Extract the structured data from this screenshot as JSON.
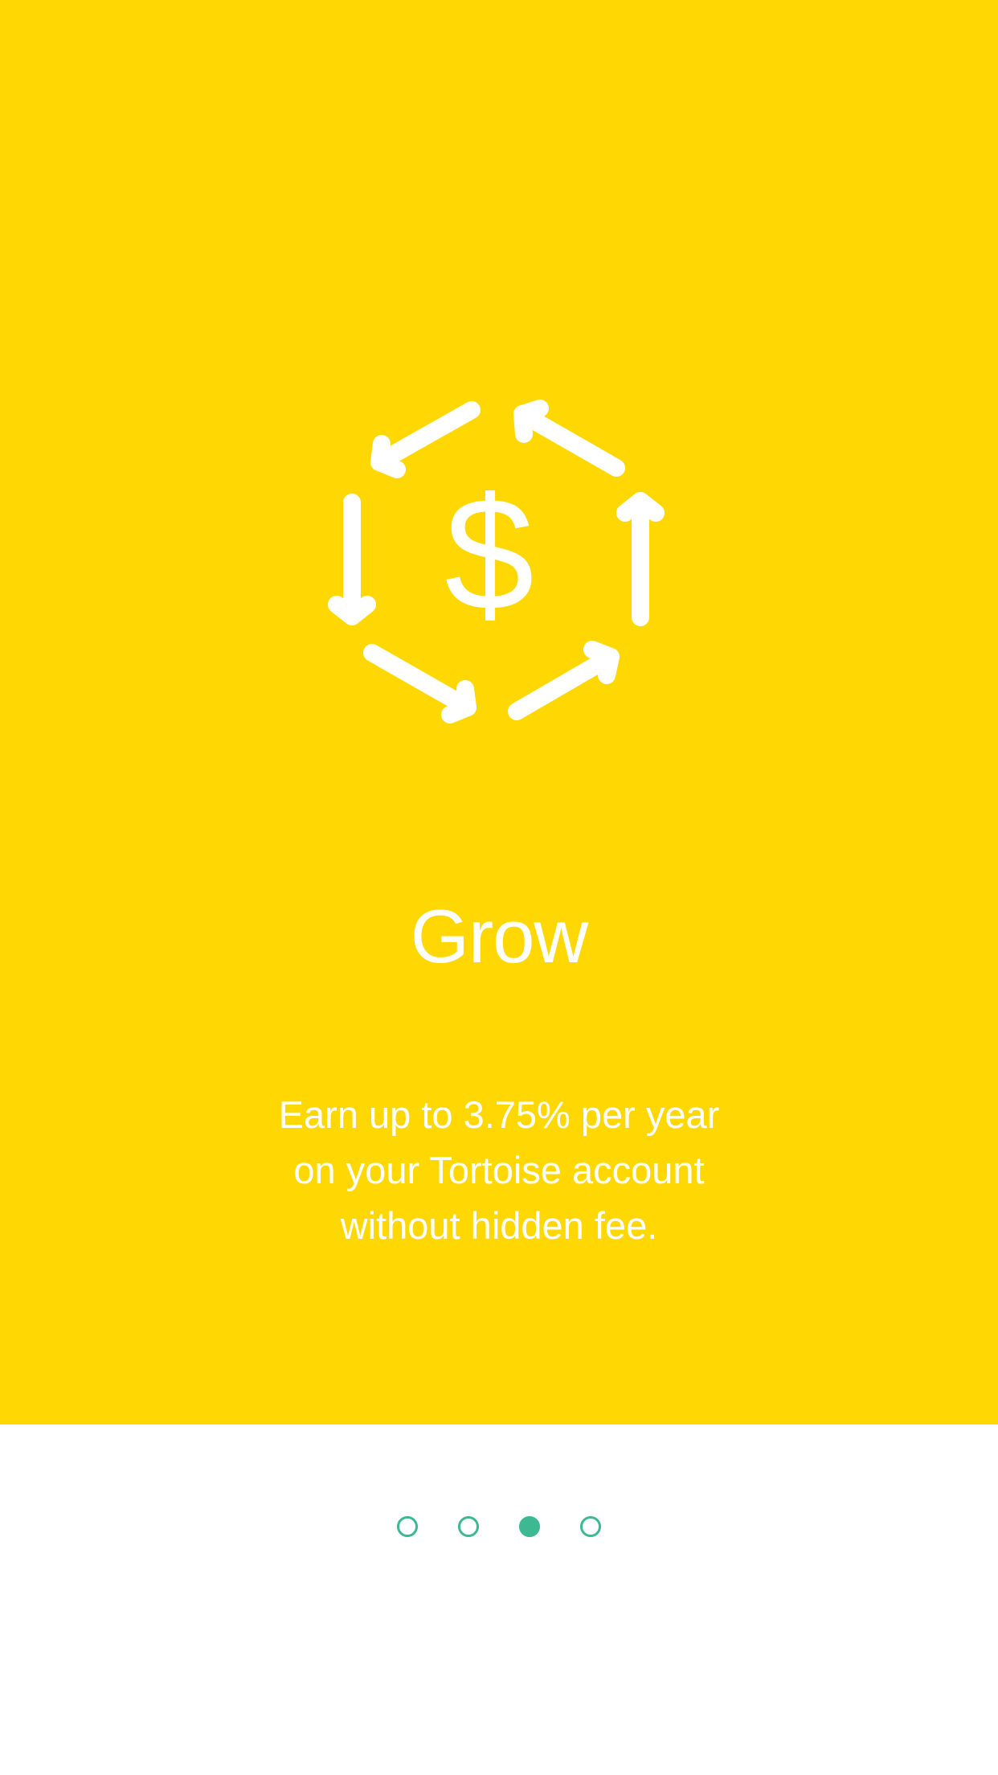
{
  "onboarding": {
    "icon": "dollar-cycle-arrows-icon",
    "title": "Grow",
    "subtitle": "Earn up to 3.75% per year\non your Tortoise account\nwithout hidden fee.",
    "dollar_sign": "$"
  },
  "pager": {
    "count": 4,
    "active_index": 2
  },
  "colors": {
    "hero_background": "#FFD803",
    "foreground": "#FFFFFF",
    "accent": "#3CB991",
    "page_background": "#FFFFFF"
  }
}
